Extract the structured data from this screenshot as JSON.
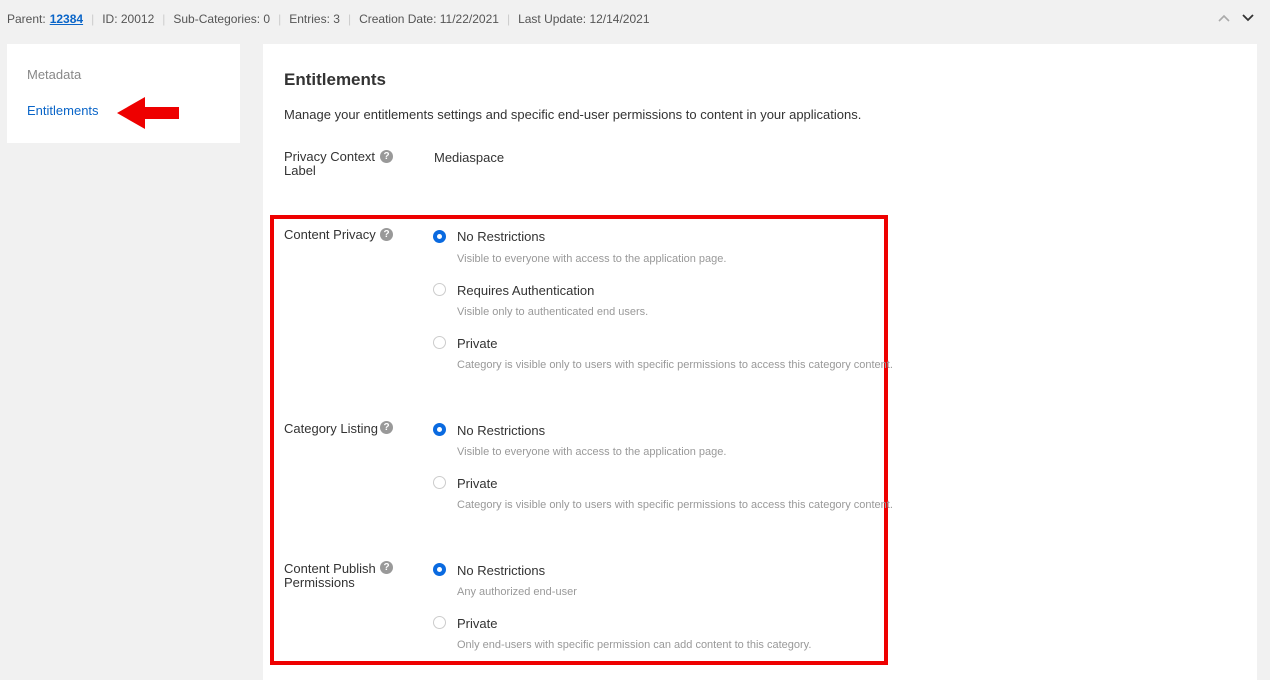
{
  "topbar": {
    "parent_label": "Parent:",
    "parent_value": "12384",
    "id": "ID: 20012",
    "sub_categories": "Sub-Categories: 0",
    "entries": "Entries: 3",
    "creation_date": "Creation Date: 11/22/2021",
    "last_update": "Last Update: 12/14/2021"
  },
  "sidebar": {
    "items": [
      {
        "label": "Metadata"
      },
      {
        "label": "Entitlements"
      }
    ]
  },
  "main": {
    "title": "Entitlements",
    "description": "Manage your entitlements settings and specific end-user permissions to content in your applications.",
    "privacy_context": {
      "label": "Privacy Context Label",
      "value": "Mediaspace"
    },
    "content_privacy": {
      "label": "Content Privacy",
      "options": [
        {
          "label": "No Restrictions",
          "desc": "Visible to everyone with access to the application page."
        },
        {
          "label": "Requires Authentication",
          "desc": "Visible only to authenticated end users."
        },
        {
          "label": "Private",
          "desc": "Category is visible only to users with specific permissions to access this category content."
        }
      ]
    },
    "category_listing": {
      "label": "Category Listing",
      "options": [
        {
          "label": "No Restrictions",
          "desc": "Visible to everyone with access to the application page."
        },
        {
          "label": "Private",
          "desc": "Category is visible only to users with specific permissions to access this category content."
        }
      ]
    },
    "content_publish": {
      "label": "Content Publish Permissions",
      "options": [
        {
          "label": "No Restrictions",
          "desc": "Any authorized end-user"
        },
        {
          "label": "Private",
          "desc": "Only end-users with specific permission can add content to this category."
        }
      ]
    }
  },
  "help_glyph": "?",
  "colors": {
    "accent": "#0a65c8",
    "highlight": "#e00000"
  }
}
